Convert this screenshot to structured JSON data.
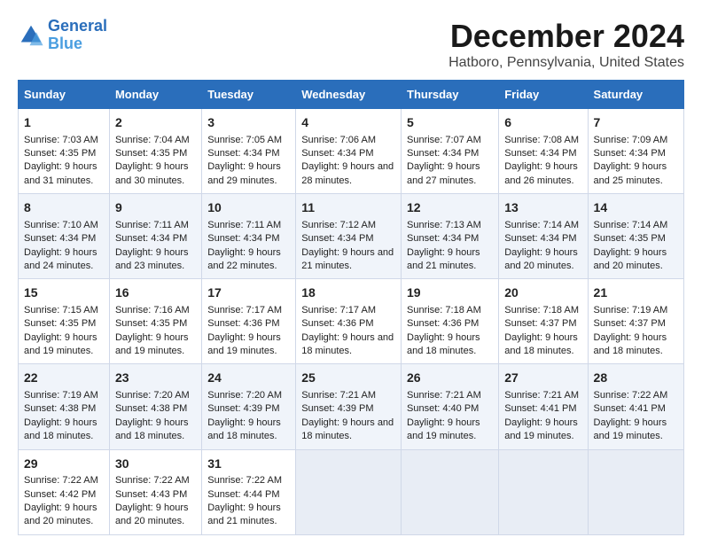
{
  "header": {
    "logo_line1": "General",
    "logo_line2": "Blue",
    "title": "December 2024",
    "subtitle": "Hatboro, Pennsylvania, United States"
  },
  "days_of_week": [
    "Sunday",
    "Monday",
    "Tuesday",
    "Wednesday",
    "Thursday",
    "Friday",
    "Saturday"
  ],
  "weeks": [
    [
      {
        "day": "1",
        "sunrise": "Sunrise: 7:03 AM",
        "sunset": "Sunset: 4:35 PM",
        "daylight": "Daylight: 9 hours and 31 minutes."
      },
      {
        "day": "2",
        "sunrise": "Sunrise: 7:04 AM",
        "sunset": "Sunset: 4:35 PM",
        "daylight": "Daylight: 9 hours and 30 minutes."
      },
      {
        "day": "3",
        "sunrise": "Sunrise: 7:05 AM",
        "sunset": "Sunset: 4:34 PM",
        "daylight": "Daylight: 9 hours and 29 minutes."
      },
      {
        "day": "4",
        "sunrise": "Sunrise: 7:06 AM",
        "sunset": "Sunset: 4:34 PM",
        "daylight": "Daylight: 9 hours and 28 minutes."
      },
      {
        "day": "5",
        "sunrise": "Sunrise: 7:07 AM",
        "sunset": "Sunset: 4:34 PM",
        "daylight": "Daylight: 9 hours and 27 minutes."
      },
      {
        "day": "6",
        "sunrise": "Sunrise: 7:08 AM",
        "sunset": "Sunset: 4:34 PM",
        "daylight": "Daylight: 9 hours and 26 minutes."
      },
      {
        "day": "7",
        "sunrise": "Sunrise: 7:09 AM",
        "sunset": "Sunset: 4:34 PM",
        "daylight": "Daylight: 9 hours and 25 minutes."
      }
    ],
    [
      {
        "day": "8",
        "sunrise": "Sunrise: 7:10 AM",
        "sunset": "Sunset: 4:34 PM",
        "daylight": "Daylight: 9 hours and 24 minutes."
      },
      {
        "day": "9",
        "sunrise": "Sunrise: 7:11 AM",
        "sunset": "Sunset: 4:34 PM",
        "daylight": "Daylight: 9 hours and 23 minutes."
      },
      {
        "day": "10",
        "sunrise": "Sunrise: 7:11 AM",
        "sunset": "Sunset: 4:34 PM",
        "daylight": "Daylight: 9 hours and 22 minutes."
      },
      {
        "day": "11",
        "sunrise": "Sunrise: 7:12 AM",
        "sunset": "Sunset: 4:34 PM",
        "daylight": "Daylight: 9 hours and 21 minutes."
      },
      {
        "day": "12",
        "sunrise": "Sunrise: 7:13 AM",
        "sunset": "Sunset: 4:34 PM",
        "daylight": "Daylight: 9 hours and 21 minutes."
      },
      {
        "day": "13",
        "sunrise": "Sunrise: 7:14 AM",
        "sunset": "Sunset: 4:34 PM",
        "daylight": "Daylight: 9 hours and 20 minutes."
      },
      {
        "day": "14",
        "sunrise": "Sunrise: 7:14 AM",
        "sunset": "Sunset: 4:35 PM",
        "daylight": "Daylight: 9 hours and 20 minutes."
      }
    ],
    [
      {
        "day": "15",
        "sunrise": "Sunrise: 7:15 AM",
        "sunset": "Sunset: 4:35 PM",
        "daylight": "Daylight: 9 hours and 19 minutes."
      },
      {
        "day": "16",
        "sunrise": "Sunrise: 7:16 AM",
        "sunset": "Sunset: 4:35 PM",
        "daylight": "Daylight: 9 hours and 19 minutes."
      },
      {
        "day": "17",
        "sunrise": "Sunrise: 7:17 AM",
        "sunset": "Sunset: 4:36 PM",
        "daylight": "Daylight: 9 hours and 19 minutes."
      },
      {
        "day": "18",
        "sunrise": "Sunrise: 7:17 AM",
        "sunset": "Sunset: 4:36 PM",
        "daylight": "Daylight: 9 hours and 18 minutes."
      },
      {
        "day": "19",
        "sunrise": "Sunrise: 7:18 AM",
        "sunset": "Sunset: 4:36 PM",
        "daylight": "Daylight: 9 hours and 18 minutes."
      },
      {
        "day": "20",
        "sunrise": "Sunrise: 7:18 AM",
        "sunset": "Sunset: 4:37 PM",
        "daylight": "Daylight: 9 hours and 18 minutes."
      },
      {
        "day": "21",
        "sunrise": "Sunrise: 7:19 AM",
        "sunset": "Sunset: 4:37 PM",
        "daylight": "Daylight: 9 hours and 18 minutes."
      }
    ],
    [
      {
        "day": "22",
        "sunrise": "Sunrise: 7:19 AM",
        "sunset": "Sunset: 4:38 PM",
        "daylight": "Daylight: 9 hours and 18 minutes."
      },
      {
        "day": "23",
        "sunrise": "Sunrise: 7:20 AM",
        "sunset": "Sunset: 4:38 PM",
        "daylight": "Daylight: 9 hours and 18 minutes."
      },
      {
        "day": "24",
        "sunrise": "Sunrise: 7:20 AM",
        "sunset": "Sunset: 4:39 PM",
        "daylight": "Daylight: 9 hours and 18 minutes."
      },
      {
        "day": "25",
        "sunrise": "Sunrise: 7:21 AM",
        "sunset": "Sunset: 4:39 PM",
        "daylight": "Daylight: 9 hours and 18 minutes."
      },
      {
        "day": "26",
        "sunrise": "Sunrise: 7:21 AM",
        "sunset": "Sunset: 4:40 PM",
        "daylight": "Daylight: 9 hours and 19 minutes."
      },
      {
        "day": "27",
        "sunrise": "Sunrise: 7:21 AM",
        "sunset": "Sunset: 4:41 PM",
        "daylight": "Daylight: 9 hours and 19 minutes."
      },
      {
        "day": "28",
        "sunrise": "Sunrise: 7:22 AM",
        "sunset": "Sunset: 4:41 PM",
        "daylight": "Daylight: 9 hours and 19 minutes."
      }
    ],
    [
      {
        "day": "29",
        "sunrise": "Sunrise: 7:22 AM",
        "sunset": "Sunset: 4:42 PM",
        "daylight": "Daylight: 9 hours and 20 minutes."
      },
      {
        "day": "30",
        "sunrise": "Sunrise: 7:22 AM",
        "sunset": "Sunset: 4:43 PM",
        "daylight": "Daylight: 9 hours and 20 minutes."
      },
      {
        "day": "31",
        "sunrise": "Sunrise: 7:22 AM",
        "sunset": "Sunset: 4:44 PM",
        "daylight": "Daylight: 9 hours and 21 minutes."
      },
      null,
      null,
      null,
      null
    ]
  ]
}
